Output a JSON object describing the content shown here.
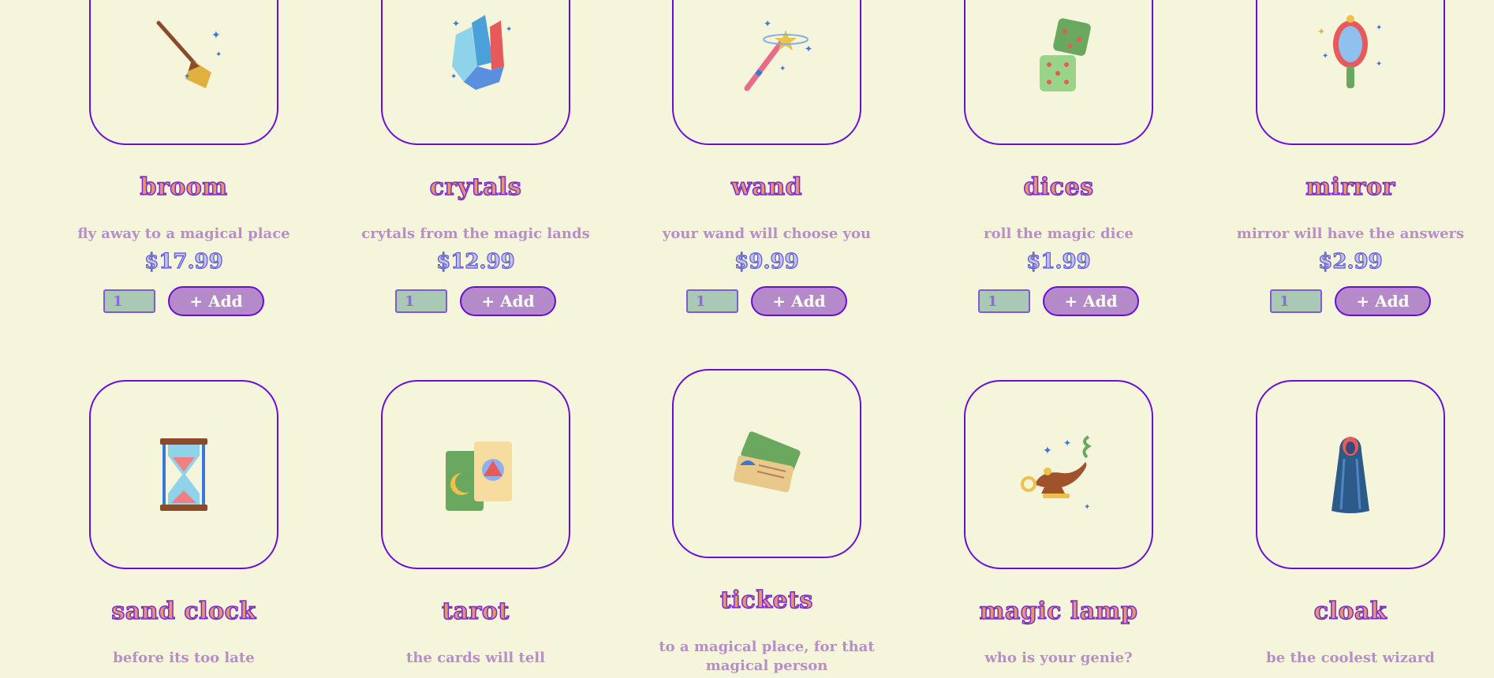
{
  "products": [
    {
      "name": "broom",
      "desc": "fly away to a magical place",
      "price": "$17.99",
      "qty": "1",
      "add": "+ Add",
      "icon": "broom-icon"
    },
    {
      "name": "crytals",
      "desc": "crytals from the magic lands",
      "price": "$12.99",
      "qty": "1",
      "add": "+ Add",
      "icon": "crystals-icon"
    },
    {
      "name": "wand",
      "desc": "your wand will choose you",
      "price": "$9.99",
      "qty": "1",
      "add": "+ Add",
      "icon": "wand-icon"
    },
    {
      "name": "dices",
      "desc": "roll the magic dice",
      "price": "$1.99",
      "qty": "1",
      "add": "+ Add",
      "icon": "dice-icon"
    },
    {
      "name": "mirror",
      "desc": "mirror will have the answers",
      "price": "$2.99",
      "qty": "1",
      "add": "+ Add",
      "icon": "mirror-icon"
    },
    {
      "name": "sand clock",
      "desc": "before its too late",
      "icon": "hourglass-icon"
    },
    {
      "name": "tarot",
      "desc": "the cards will tell",
      "icon": "tarot-icon"
    },
    {
      "name": "tickets",
      "desc": "to a magical place, for that magical person",
      "icon": "tickets-icon"
    },
    {
      "name": "magic lamp",
      "desc": "who is your genie?",
      "icon": "lamp-icon"
    },
    {
      "name": "cloak",
      "desc": "be the coolest wizard",
      "icon": "cloak-icon"
    }
  ],
  "colors": {
    "background": "#f5f5dc",
    "border": "#6a0dd8",
    "title_fill": "#e8956e",
    "desc": "#b78ec8",
    "button": "#b48ac8",
    "qty_bg": "#a9c9b6"
  }
}
